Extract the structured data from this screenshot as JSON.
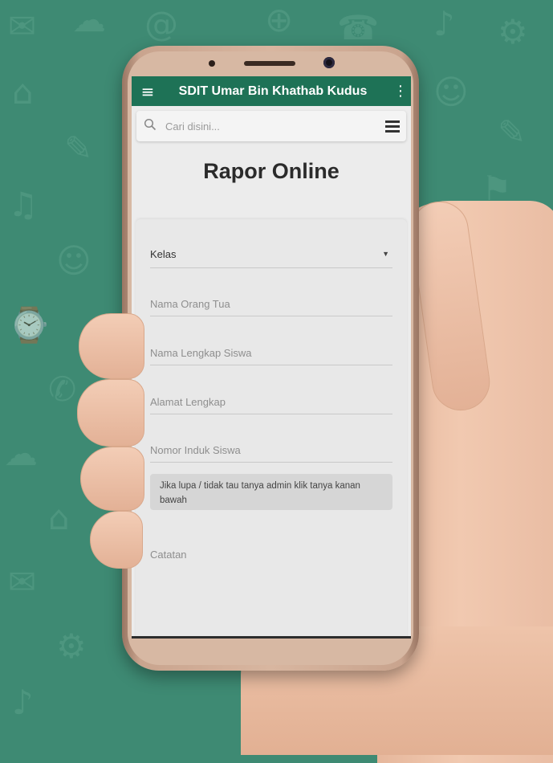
{
  "app": {
    "title": "SDIT Umar Bin Khathab Kudus"
  },
  "search": {
    "placeholder": "Cari disini..."
  },
  "page": {
    "heading": "Rapor Online"
  },
  "form": {
    "kelas_label": "Kelas",
    "parent_name_placeholder": "Nama Orang Tua",
    "student_name_placeholder": "Nama Lengkap Siswa",
    "address_placeholder": "Alamat Lengkap",
    "student_id_placeholder": "Nomor Induk Siswa",
    "help_text": "Jika lupa / tidak tau tanya admin klik tanya kanan bawah",
    "notes_placeholder": "Catatan"
  },
  "colors": {
    "appbar": "#1e7256",
    "background": "#3e8a73"
  },
  "icons": {
    "menu": "hamburger-icon",
    "more": "more-vertical-icon",
    "search": "search-icon",
    "list": "list-menu-icon",
    "dropdown": "dropdown-arrow-icon"
  }
}
